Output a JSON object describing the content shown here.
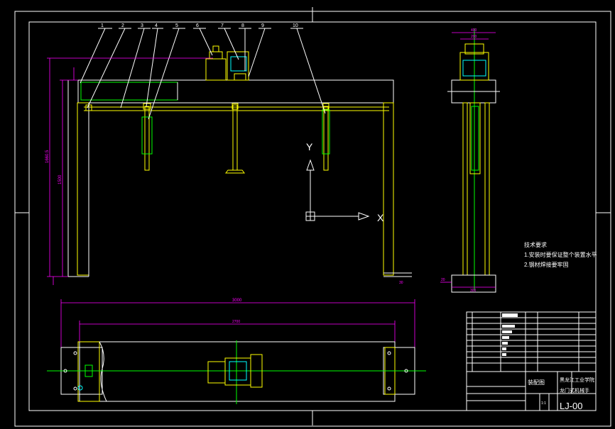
{
  "part_numbers": [
    "1",
    "2",
    "3",
    "4",
    "5",
    "6",
    "7",
    "8",
    "9",
    "10"
  ],
  "dimensions": {
    "height_total": "1660.5",
    "height_inner": "1500",
    "width_total": "3000",
    "width_inner": "2700",
    "side_width": "300",
    "small_200": "200",
    "small_400": "400",
    "small_20": "20",
    "small_30": "30"
  },
  "axis_labels": {
    "y": "Y",
    "x": "X"
  },
  "notes": {
    "title": "技术要求",
    "line1": "1.安装时要保证整个装置水平",
    "line2": "2.钢材焊接要牢固"
  },
  "title_block": {
    "drawing_name": "装配图",
    "school": "黑龙江工业学院",
    "product": "龙门式机械手",
    "drawing_no": "LJ-00",
    "scale": "1:1"
  },
  "colors": {
    "frame": "#ffffff",
    "structure": "#ffff00",
    "dimension": "#ff00ff",
    "centerline": "#00ff00",
    "part": "#00ffff"
  }
}
